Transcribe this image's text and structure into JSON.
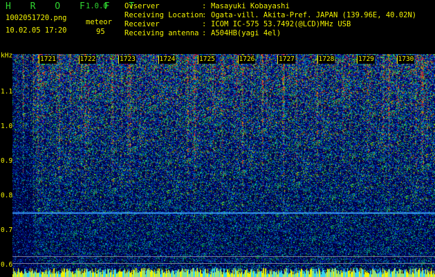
{
  "header": {
    "app_name": "H R O F F T",
    "version": "1.0.0",
    "filename": "1002051720.png",
    "datetime": "10.02.05 17:20",
    "meteor_label": "meteor",
    "meteor_count": "95"
  },
  "info": [
    {
      "label": "Ovserver",
      "value": "Masayuki Kobayashi"
    },
    {
      "label": "Receiving Location",
      "value": "Ogata-vill. Akita-Pref. JAPAN (139.96E, 40.02N)"
    },
    {
      "label": "Receiver",
      "value": "ICOM IC-575 53.7492(@LCD)MHz USB"
    },
    {
      "label": "Receiving antenna",
      "value": "A504HB(yagi 4el)"
    }
  ],
  "colon": ":",
  "axis": {
    "unit": "kHz",
    "ticks": [
      "1.1",
      "1.0",
      "0.9",
      "0.8",
      "0.7",
      "0.6"
    ],
    "tick_values": [
      1.1,
      1.0,
      0.9,
      0.8,
      0.7,
      0.6
    ],
    "range": [
      0.565,
      1.21
    ]
  },
  "time_marks": [
    "1721",
    "1722",
    "1723",
    "1724",
    "1725",
    "1726",
    "1727",
    "1728",
    "1729",
    "1730"
  ],
  "colors": {
    "text": "#f2f200",
    "logo": "#2fd52f",
    "background_noise": "#000030",
    "reference_line": "#3aa0ff"
  }
}
